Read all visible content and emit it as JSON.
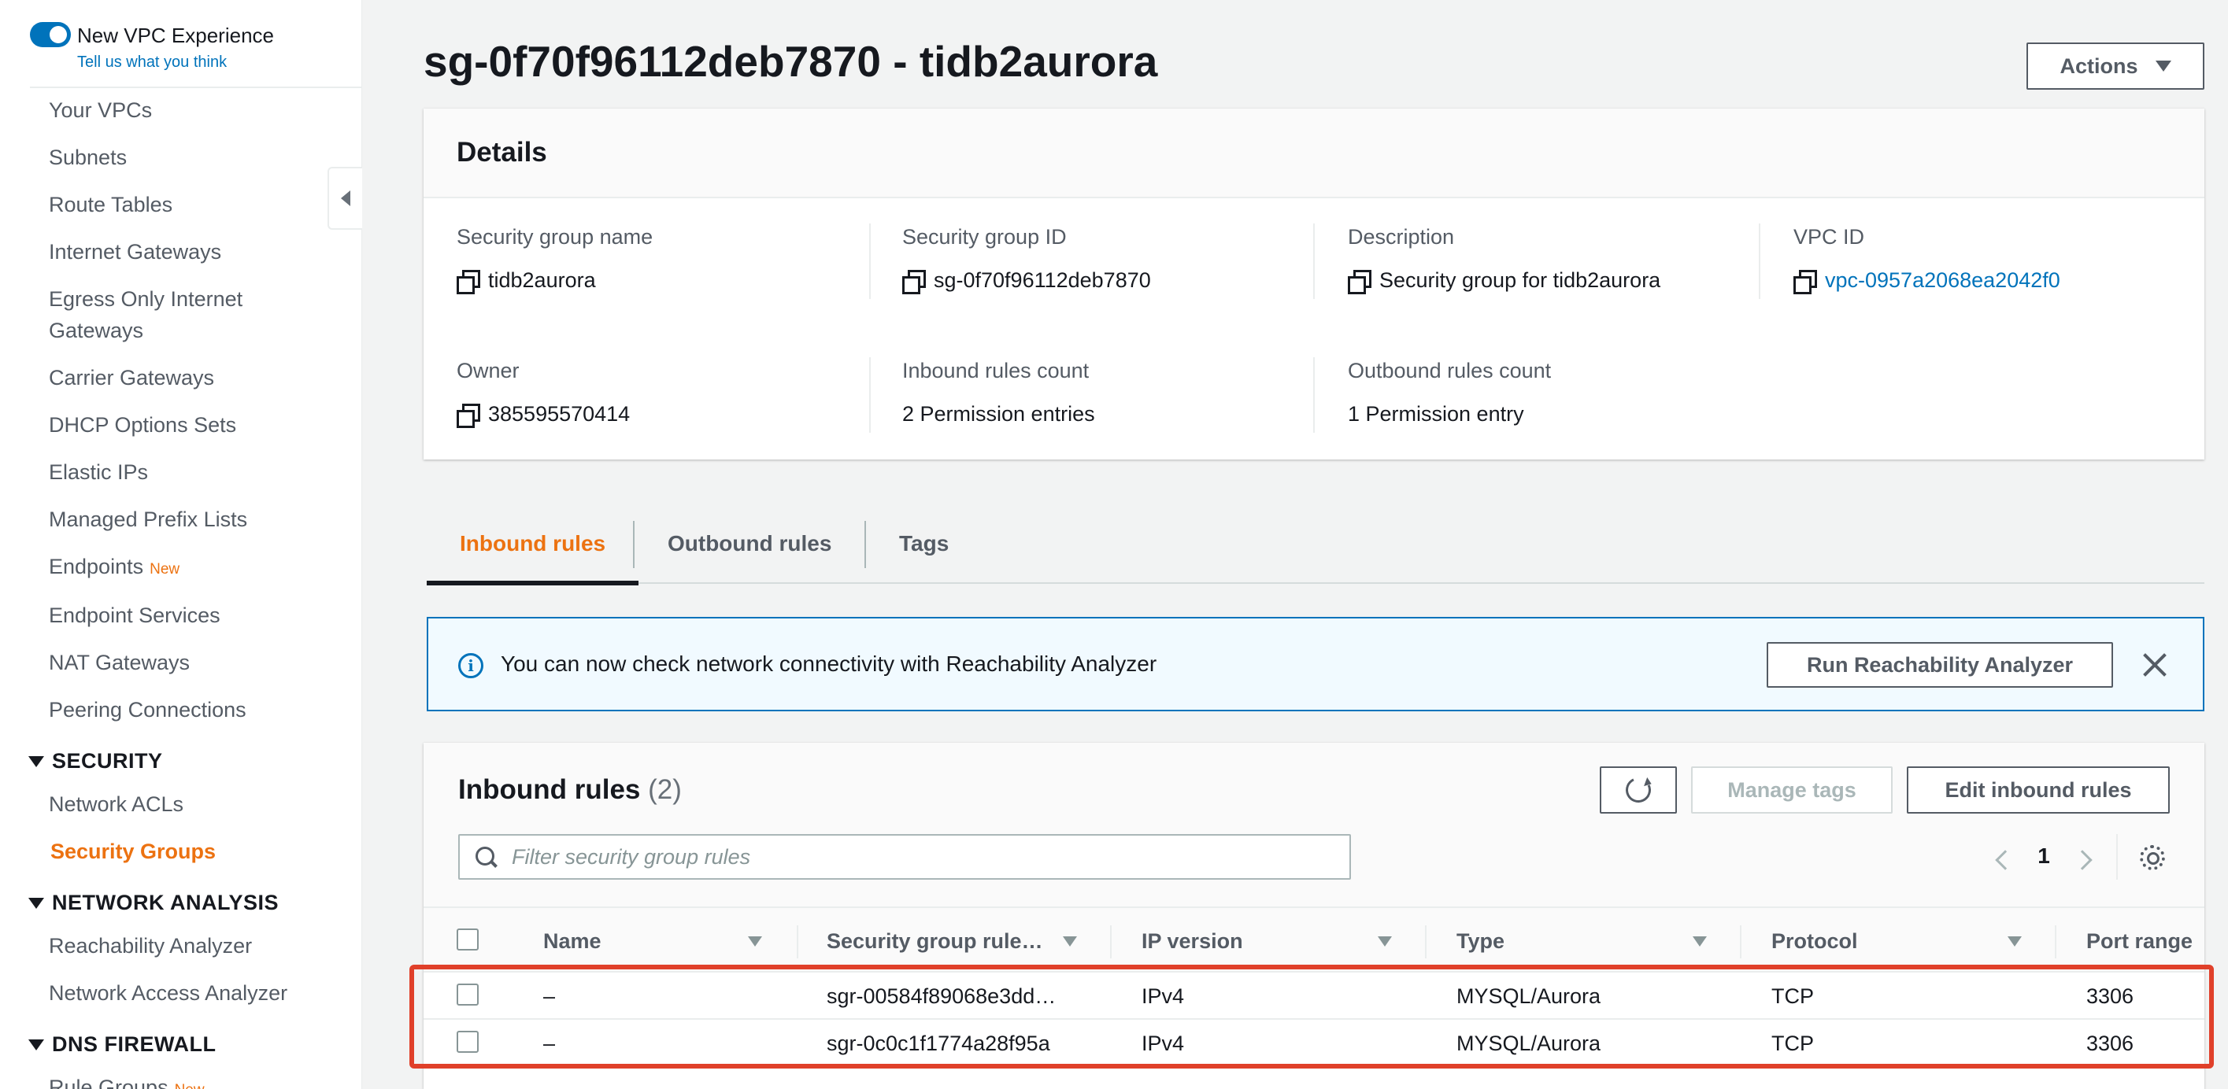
{
  "sidebar": {
    "toggle_label": "New VPC Experience",
    "toggle_feedback": "Tell us what you think",
    "items": [
      {
        "label": "Your VPCs"
      },
      {
        "label": "Subnets"
      },
      {
        "label": "Route Tables"
      },
      {
        "label": "Internet Gateways"
      },
      {
        "label": "Egress Only Internet Gateways"
      },
      {
        "label": "Carrier Gateways"
      },
      {
        "label": "DHCP Options Sets"
      },
      {
        "label": "Elastic IPs"
      },
      {
        "label": "Managed Prefix Lists"
      },
      {
        "label": "Endpoints",
        "badge": "New"
      },
      {
        "label": "Endpoint Services"
      },
      {
        "label": "NAT Gateways"
      },
      {
        "label": "Peering Connections"
      }
    ],
    "sections": {
      "security": {
        "title": "SECURITY",
        "items": [
          {
            "label": "Network ACLs"
          },
          {
            "label": "Security Groups"
          }
        ]
      },
      "network_analysis": {
        "title": "NETWORK ANALYSIS",
        "items": [
          {
            "label": "Reachability Analyzer"
          },
          {
            "label": "Network Access Analyzer"
          }
        ]
      },
      "dns_firewall": {
        "title": "DNS FIREWALL",
        "items": [
          {
            "label": "Rule Groups",
            "badge": "New"
          }
        ]
      }
    }
  },
  "page": {
    "title": "sg-0f70f96112deb7870 - tidb2aurora",
    "actions_label": "Actions"
  },
  "details": {
    "title": "Details",
    "fields": {
      "sg_name": {
        "label": "Security group name",
        "value": "tidb2aurora"
      },
      "sg_id": {
        "label": "Security group ID",
        "value": "sg-0f70f96112deb7870"
      },
      "description": {
        "label": "Description",
        "value": "Security group for tidb2aurora"
      },
      "vpc_id": {
        "label": "VPC ID",
        "value": "vpc-0957a2068ea2042f0"
      },
      "owner": {
        "label": "Owner",
        "value": "385595570414"
      },
      "inbound_count": {
        "label": "Inbound rules count",
        "value": "2 Permission entries"
      },
      "outbound_count": {
        "label": "Outbound rules count",
        "value": "1 Permission entry"
      }
    }
  },
  "tabs": [
    {
      "label": "Inbound rules",
      "active": true
    },
    {
      "label": "Outbound rules",
      "active": false
    },
    {
      "label": "Tags",
      "active": false
    }
  ],
  "alert": {
    "text": "You can now check network connectivity with Reachability Analyzer",
    "button_label": "Run Reachability Analyzer"
  },
  "rules": {
    "title": "Inbound rules",
    "count": "(2)",
    "manage_tags_label": "Manage tags",
    "edit_label": "Edit inbound rules",
    "filter_placeholder": "Filter security group rules",
    "page_number": "1",
    "columns": [
      "Name",
      "Security group rule…",
      "IP version",
      "Type",
      "Protocol",
      "Port range"
    ],
    "rows": [
      {
        "name": "–",
        "rule_id": "sgr-00584f89068e3dd…",
        "ip_version": "IPv4",
        "type": "MYSQL/Aurora",
        "protocol": "TCP",
        "port_range": "3306"
      },
      {
        "name": "–",
        "rule_id": "sgr-0c0c1f1774a28f95a",
        "ip_version": "IPv4",
        "type": "MYSQL/Aurora",
        "protocol": "TCP",
        "port_range": "3306"
      }
    ]
  },
  "colors": {
    "accent": "#ec7211",
    "link": "#0073bb",
    "highlight_annotation": "#e0402a"
  }
}
